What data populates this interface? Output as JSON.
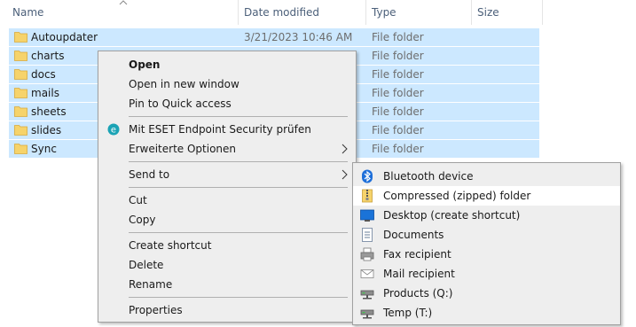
{
  "columns": {
    "name": "Name",
    "date_modified": "Date modified",
    "type": "Type",
    "size": "Size"
  },
  "files": [
    {
      "name": "Autoupdater",
      "date": "3/21/2023 10:46 AM",
      "type": "File folder"
    },
    {
      "name": "charts",
      "date": "",
      "type": "File folder"
    },
    {
      "name": "docs",
      "date": "",
      "type": "File folder"
    },
    {
      "name": "mails",
      "date": "",
      "type": "File folder"
    },
    {
      "name": "sheets",
      "date": "",
      "type": "File folder"
    },
    {
      "name": "slides",
      "date": "",
      "type": "File folder"
    },
    {
      "name": "Sync",
      "date": "",
      "type": "File folder"
    }
  ],
  "context_menu": {
    "open": "Open",
    "open_new_window": "Open in new window",
    "pin_quick_access": "Pin to Quick access",
    "eset": "Mit ESET Endpoint Security prüfen",
    "advanced": "Erweiterte Optionen",
    "send_to": "Send to",
    "cut": "Cut",
    "copy": "Copy",
    "create_shortcut": "Create shortcut",
    "delete": "Delete",
    "rename": "Rename",
    "properties": "Properties"
  },
  "send_to_menu": {
    "bluetooth": "Bluetooth device",
    "compressed": "Compressed (zipped) folder",
    "desktop": "Desktop (create shortcut)",
    "documents": "Documents",
    "fax": "Fax recipient",
    "mail": "Mail recipient",
    "products": "Products (Q:)",
    "temp": "Temp (T:)"
  },
  "colors": {
    "selection": "#cce8ff",
    "menu_bg": "#eeeeee",
    "folder": "#f6d36b",
    "header_text": "#4c607a"
  }
}
